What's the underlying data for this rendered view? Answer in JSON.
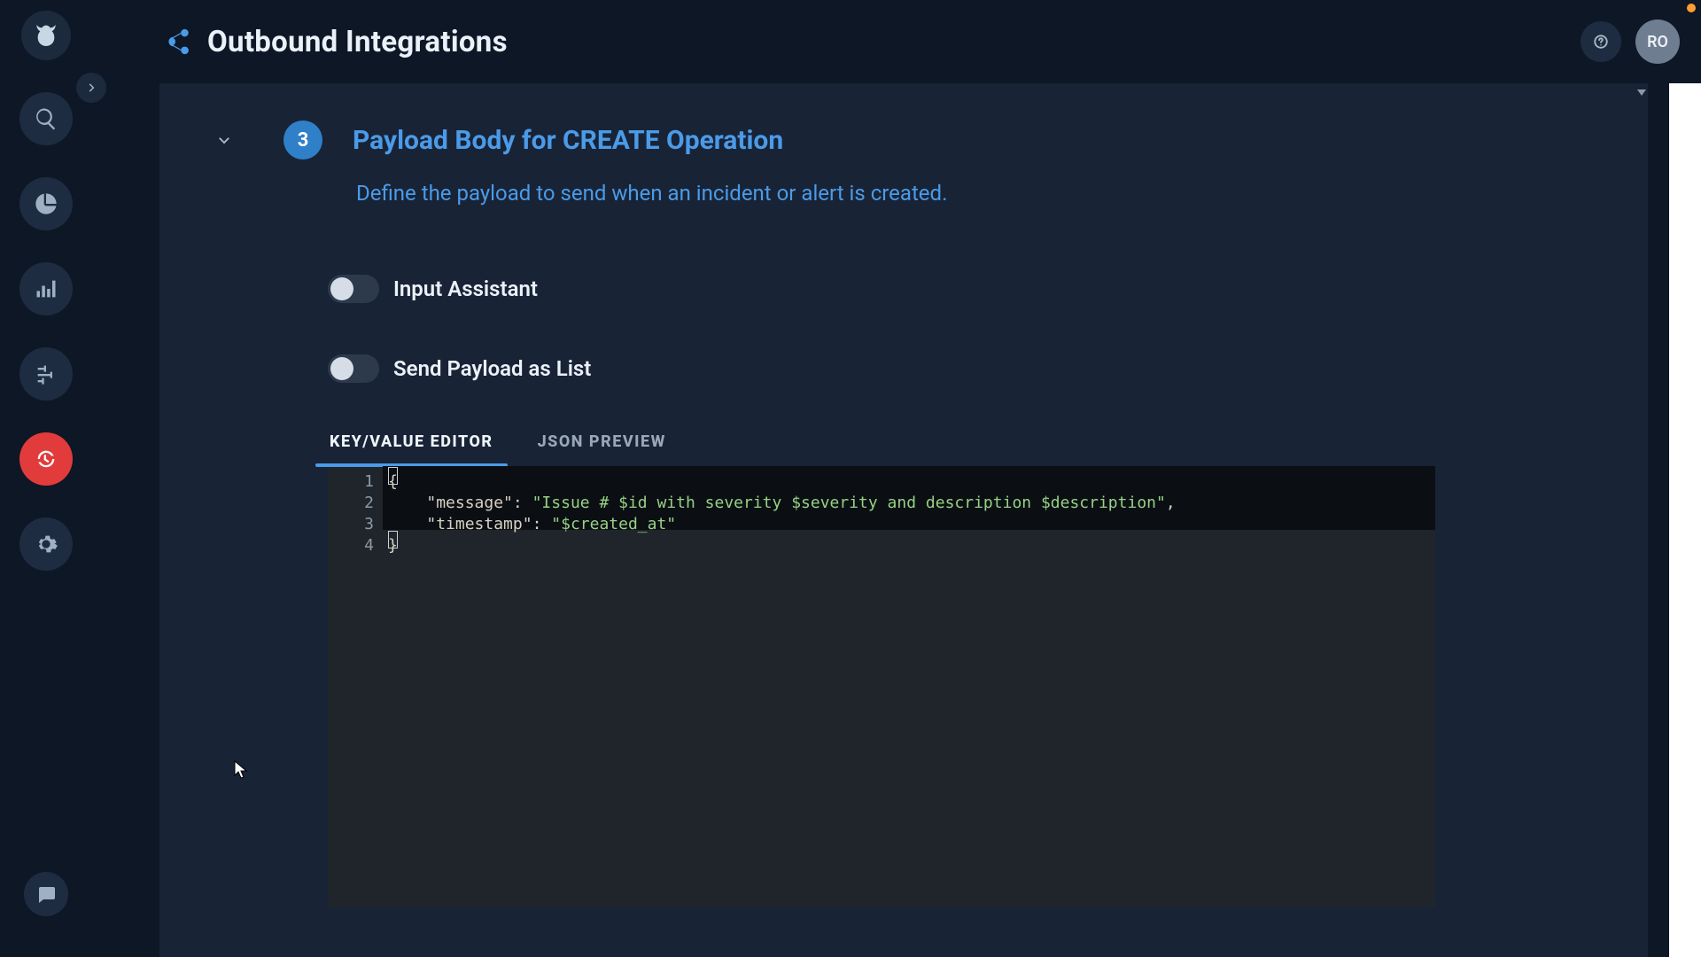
{
  "header": {
    "title": "Outbound Integrations",
    "avatar_initials": "RO"
  },
  "step": {
    "number": "3",
    "title": "Payload Body for CREATE Operation",
    "description": "Define the payload to send when an incident or alert is created."
  },
  "toggles": {
    "input_assistant": "Input Assistant",
    "send_as_list": "Send Payload as List"
  },
  "tabs": {
    "kv": "KEY/VALUE EDITOR",
    "json": "JSON PREVIEW"
  },
  "editor": {
    "gutter": [
      "1",
      "2",
      "3",
      "4"
    ],
    "lines": {
      "l1": "{",
      "l2_key": "\"message\"",
      "l2_sep": ": ",
      "l2_val": "\"Issue # $id with severity $severity and description $description\"",
      "l2_tail": ",",
      "l3_key": "\"timestamp\"",
      "l3_sep": ": ",
      "l3_val": "\"$created_at\"",
      "l4": "}"
    }
  }
}
